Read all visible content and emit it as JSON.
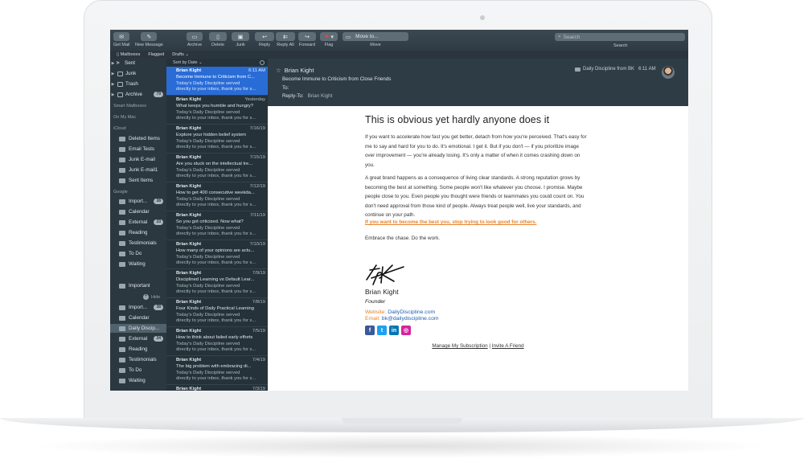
{
  "toolbar": {
    "get_mail": "Get Mail",
    "new_message": "New Message",
    "archive": "Archive",
    "delete": "Delete",
    "junk": "Junk",
    "reply": "Reply",
    "reply_all": "Reply All",
    "forward": "Forward",
    "flag": "Flag",
    "move_to": "Move to...",
    "move": "Move",
    "search_placeholder": "Search",
    "search_label": "Search"
  },
  "favorites": {
    "mailboxes": "Mailboxes",
    "flagged": "Flagged",
    "drafts": "Drafts"
  },
  "sidebar": {
    "top": [
      {
        "label": "Sent"
      },
      {
        "label": "Junk"
      },
      {
        "label": "Trash"
      },
      {
        "label": "Archive",
        "badge": "79"
      }
    ],
    "smart_mailboxes": "Smart Mailboxes",
    "on_my_mac": "On My Mac",
    "icloud": "iCloud",
    "icloud_items": [
      {
        "label": "Deleted Items"
      },
      {
        "label": "Email Tests"
      },
      {
        "label": "Junk E-mail"
      },
      {
        "label": "Junk E-mail1"
      },
      {
        "label": "Sent Items"
      }
    ],
    "google": "Google",
    "google_items": [
      {
        "label": "Import...",
        "badge": "38"
      },
      {
        "label": "Calendar"
      },
      {
        "label": "External",
        "badge": "33"
      },
      {
        "label": "Reading"
      },
      {
        "label": "Testimonials"
      },
      {
        "label": "To Do"
      },
      {
        "label": "Waiting"
      }
    ],
    "important": "Important",
    "hide": "Hide",
    "sub_items": [
      {
        "label": "Import...",
        "badge": "38"
      },
      {
        "label": "Calendar"
      },
      {
        "label": "Daily Discip..."
      },
      {
        "label": "External",
        "badge": "34"
      },
      {
        "label": "Reading"
      },
      {
        "label": "Testimonials"
      },
      {
        "label": "To Do"
      },
      {
        "label": "Waiting"
      }
    ]
  },
  "message_list": {
    "sort": "Sort by Date",
    "messages": [
      {
        "from": "Brian Kight",
        "date": "6:11 AM",
        "subject": "Become Immune to Criticism from C...",
        "preview1": "Today's Daily Discipline served",
        "preview2": "directly to your inbox, thank you for s..."
      },
      {
        "from": "Brian Kight",
        "date": "Yesterday",
        "subject": "What keeps you humble and hungry?",
        "preview1": "Today's Daily Discipline served",
        "preview2": "directly to your inbox, thank you for s..."
      },
      {
        "from": "Brian Kight",
        "date": "7/16/19",
        "subject": "Explore your hidden belief system",
        "preview1": "Today's Daily Discipline served",
        "preview2": "directly to your inbox, thank you for s..."
      },
      {
        "from": "Brian Kight",
        "date": "7/15/19",
        "subject": "Are you stuck on the intellectual tre...",
        "preview1": "Today's Daily Discipline served",
        "preview2": "directly to your inbox, thank you for s..."
      },
      {
        "from": "Brian Kight",
        "date": "7/12/19",
        "subject": "How to get 400 consecutive weekda...",
        "preview1": "Today's Daily Discipline served",
        "preview2": "directly to your inbox, thank you for s..."
      },
      {
        "from": "Brian Kight",
        "date": "7/11/19",
        "subject": "So you got criticized. Now what?",
        "preview1": "Today's Daily Discipline served",
        "preview2": "directly to your inbox, thank you for s..."
      },
      {
        "from": "Brian Kight",
        "date": "7/10/19",
        "subject": "How many of your opinions are actu...",
        "preview1": "Today's Daily Discipline served",
        "preview2": "directly to your inbox, thank you for s..."
      },
      {
        "from": "Brian Kight",
        "date": "7/9/19",
        "subject": "Disciplined Learning vs Default Lear...",
        "preview1": "Today's Daily Discipline served",
        "preview2": "directly to your inbox, thank you for s..."
      },
      {
        "from": "Brian Kight",
        "date": "7/8/19",
        "subject": "Four Kinds of Daily Practical Learning",
        "preview1": "Today's Daily Discipline served",
        "preview2": "directly to your inbox, thank you for s..."
      },
      {
        "from": "Brian Kight",
        "date": "7/5/19",
        "subject": "How to think about failed early efforts",
        "preview1": "Today's Daily Discipline served",
        "preview2": "directly to your inbox, thank you for s..."
      },
      {
        "from": "Brian Kight",
        "date": "7/4/19",
        "subject": "The big problem with embracing di...",
        "preview1": "Today's Daily Discipline served",
        "preview2": "directly to your inbox, thank you for s..."
      },
      {
        "from": "Brian Kight",
        "date": "7/3/19",
        "subject": "",
        "preview1": "",
        "preview2": ""
      }
    ]
  },
  "reader": {
    "from": "Brian Kight",
    "subject": "Become Immune to Criticism from Close Friends",
    "to_label": "To:",
    "reply_to_label": "Reply-To:",
    "reply_to_value": "Brian Kight",
    "mailbox": "Daily Discipline from BK",
    "time": "6:11 AM"
  },
  "body": {
    "title": "This is obvious yet hardly anyone does it",
    "para1": "If you want to accelerate how fast you get better, detach from how you're perceived. That's easy for me to say and hard for you to do. It's emotional. I get it. But if you don't — if you prioritize image over improvement — you're already losing. It's only a matter of when it comes crashing down on you.",
    "para2": "A great brand happens as a consequence of living clear standards. A strong reputation grows by becoming the best at something. Some people won't like whatever you choose. I promise. Maybe people close to you. Even people you thought were friends or teammates you could count on. You don't need approval from those kind of people. Always treat people well, live your standards, and continue on your path.",
    "highlight": "If you want to become the best you, stop trying to look good for others.",
    "closing": "Embrace the chase. Do the work.",
    "signature_name": "Brian Kight",
    "signature_title": "Founder",
    "website_label": "Website:",
    "website_value": "DailyDiscipline.com",
    "email_label": "Email:",
    "email_value": "bk@dailydiscipline.com",
    "manage_subscription": "Manage My Subscription",
    "separator": "|",
    "invite_friend": "Invite A Friend"
  },
  "colors": {
    "accent_blue": "#2a6cd6",
    "link_orange": "#e8822a",
    "facebook": "#3b5998",
    "twitter": "#1da1f2",
    "linkedin": "#0077b5",
    "instagram": "#d6249f"
  }
}
